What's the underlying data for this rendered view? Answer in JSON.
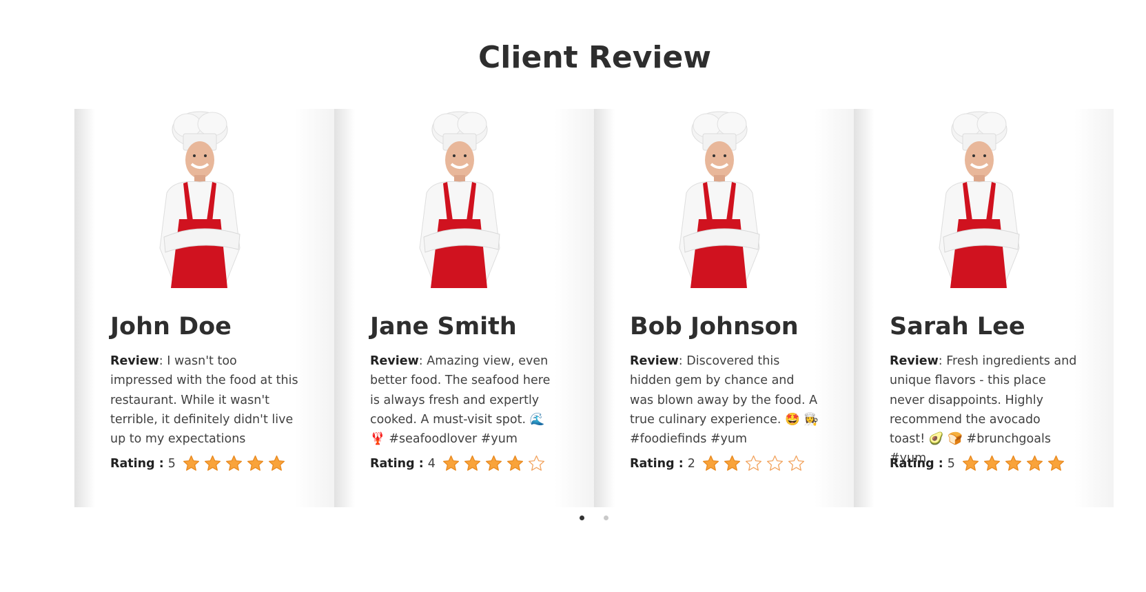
{
  "section": {
    "title": "Client Review"
  },
  "review_label": "Review",
  "rating_label": "Rating :",
  "max_stars": 5,
  "colors": {
    "star_fill": "#f9a33a",
    "star_outline": "#f2a35e",
    "apron": "#d0121f",
    "title": "#2e2e2e"
  },
  "reviews": [
    {
      "name": "John Doe",
      "text": ": I wasn't too impressed with the food at this restaurant. While it wasn't terrible, it definitely didn't live up to my expectations",
      "rating": 5
    },
    {
      "name": "Jane Smith",
      "text": ": Amazing view, even better food. The seafood here is always fresh and expertly cooked. A must-visit spot. 🌊 🦞 #seafoodlover #yum",
      "rating": 4
    },
    {
      "name": "Bob Johnson",
      "text": ": Discovered this hidden gem by chance and was blown away by the food. A true culinary experience. 🤩 👩‍🍳 #foodiefinds #yum",
      "rating": 2
    },
    {
      "name": "Sarah Lee",
      "text": ": Fresh ingredients and unique flavors - this place never disappoints. Highly recommend the avocado toast! 🥑 🍞 #brunchgoals #yum",
      "rating": 5
    }
  ],
  "pagination": {
    "pages": 2,
    "active": 0
  }
}
